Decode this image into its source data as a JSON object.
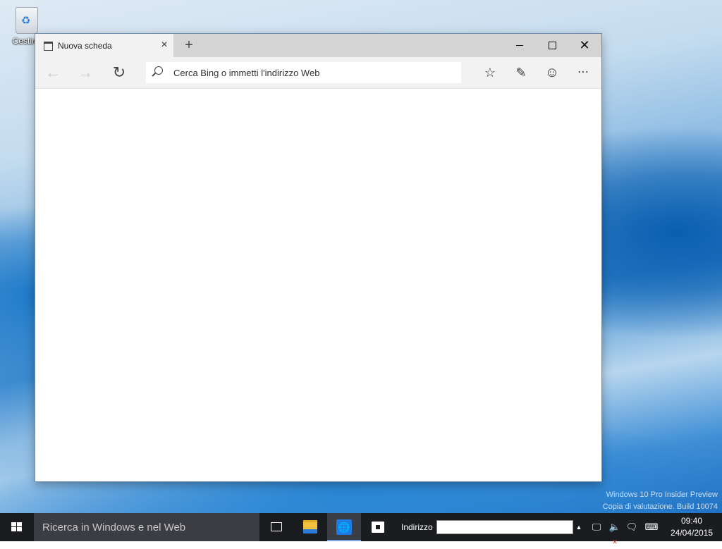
{
  "desktop": {
    "recycle_bin_label": "Cestino",
    "watermark_line1": "Windows 10 Pro Insider Preview",
    "watermark_line2": "Copia di valutazione. Build 10074"
  },
  "browser": {
    "tab_title": "Nuova scheda",
    "tab_close": "×",
    "new_tab": "+",
    "minimize_label": "",
    "maximize_label": "",
    "close_label": "✕",
    "back": "←",
    "forward": "→",
    "refresh": "↻",
    "address_placeholder": "Cerca Bing o immetti l'indirizzo Web",
    "reading_view_icon": "☆",
    "web_note_icon": "✎",
    "feedback_icon": "☺",
    "more_icon": "⋯"
  },
  "taskbar": {
    "search_placeholder": "Ricerca in Windows e nel Web",
    "address_label": "Indirizzo",
    "address_value": "",
    "tray_up": "▲",
    "network_icon": "🖵",
    "volume_icon": "🔈",
    "notify_icon": "🗨",
    "keyboard_icon": "⌨",
    "time": "09:40",
    "date": "24/04/2015"
  }
}
